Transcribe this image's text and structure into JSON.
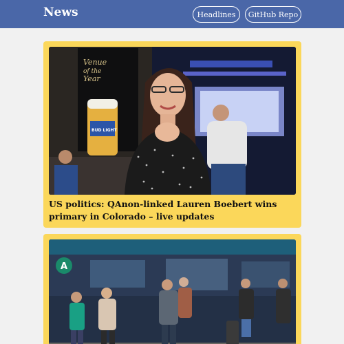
{
  "app": {
    "brand": "News"
  },
  "nav": {
    "headlines_label": "Headlines",
    "github_label": "GitHub Repo"
  },
  "articles": [
    {
      "headline": "US politics: QAnon-linked Lauren Boebert wins primary in Colorado – live updates",
      "image_label": "woman smiling at election night event",
      "sign_text": {
        "line1": "Venue",
        "line2": "of the",
        "line3": "Year",
        "beer": "BUD LIGHT"
      }
    },
    {
      "headline": "",
      "image_label": "travellers wearing masks walking through airport terminal",
      "sign_text": {
        "letter": "A"
      }
    }
  ],
  "colors": {
    "navbar": "#4a67a8",
    "card": "#fbd75a",
    "background": "#f1f1f1"
  }
}
